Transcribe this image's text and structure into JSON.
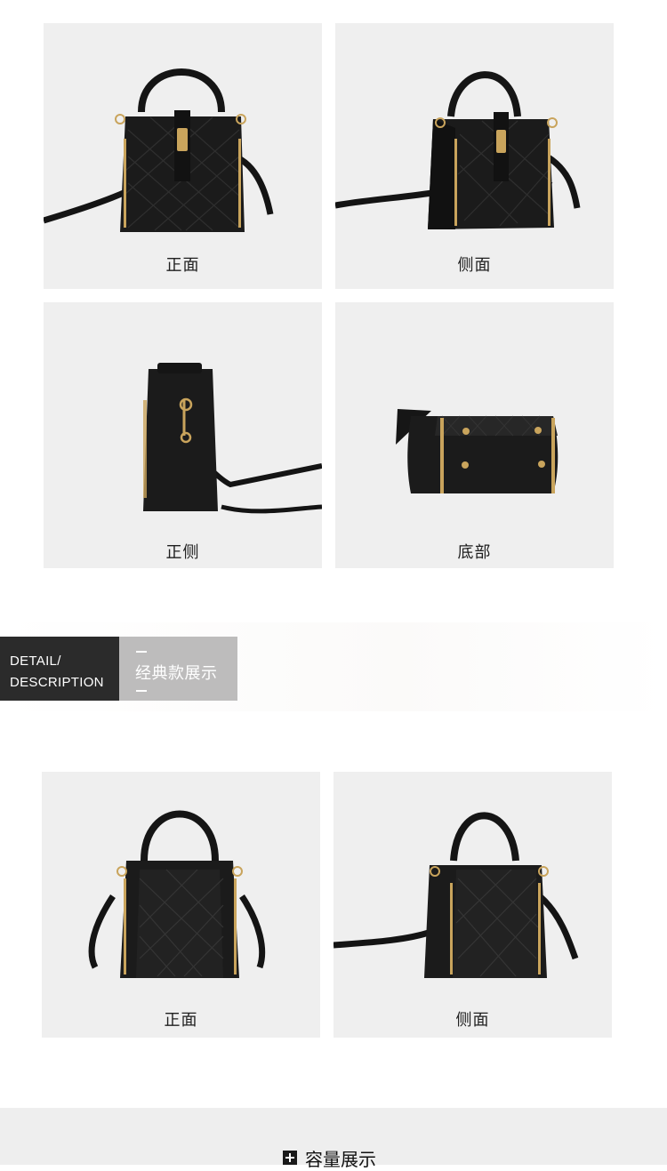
{
  "gallery_top": {
    "items": [
      {
        "caption": "正面",
        "view": "front"
      },
      {
        "caption": "侧面",
        "view": "side-angle"
      },
      {
        "caption": "正侧",
        "view": "profile"
      },
      {
        "caption": "底部",
        "view": "bottom"
      }
    ]
  },
  "section_banner": {
    "en_line1": "DETAIL/",
    "en_line2": "DESCRIPTION",
    "zh_title": "经典款展示"
  },
  "gallery_classic": {
    "items": [
      {
        "caption": "正面",
        "view": "front"
      },
      {
        "caption": "侧面",
        "view": "side-angle"
      }
    ]
  },
  "footer_section": {
    "icon": "plus-square-icon",
    "title": "容量展示"
  },
  "colors": {
    "card_bg": "#efefef",
    "bag_black": "#1b1b1b",
    "hardware_gold": "#c9a45c",
    "banner_dark": "#2b2b2b",
    "banner_light": "#bdbcbc"
  }
}
